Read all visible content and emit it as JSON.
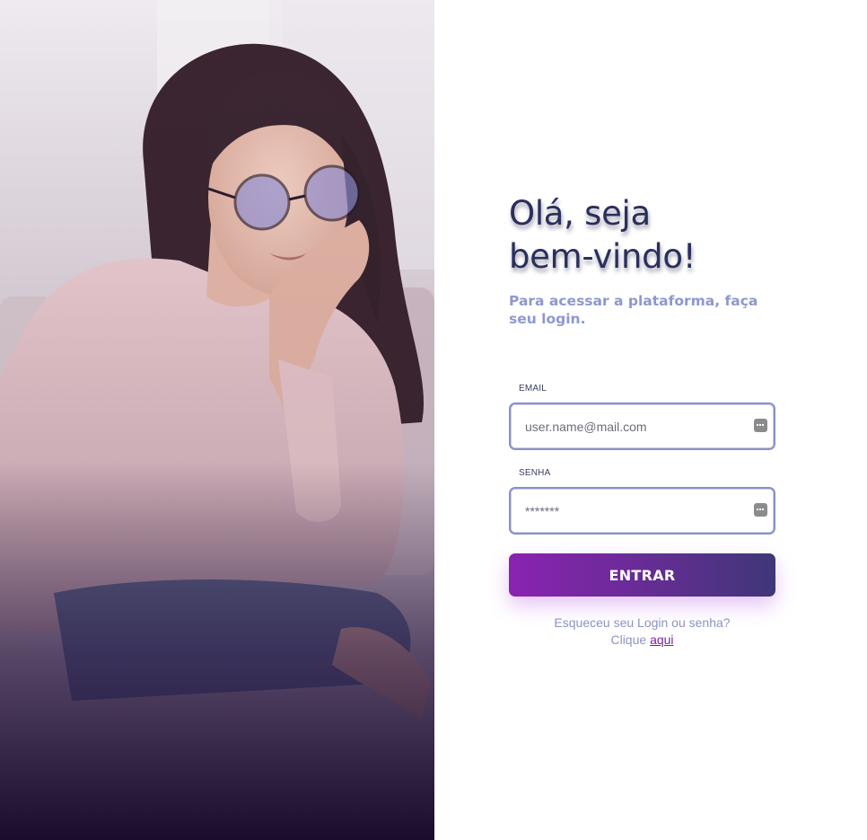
{
  "hero": {
    "photo": "woman-with-glasses-on-sofa-photo"
  },
  "login": {
    "heading_line1": "Olá, seja",
    "heading_line2": "bem-vindo!",
    "subtitle": "Para acessar a plataforma, faça seu login.",
    "email": {
      "label": "EMAIL",
      "placeholder": "user.name@mail.com",
      "icon": "password-manager-key-icon"
    },
    "password": {
      "label": "SENHA",
      "placeholder": "*******",
      "icon": "password-manager-key-icon"
    },
    "submit_label": "ENTRAR",
    "forgot_text": "Esqueceu seu Login ou senha?",
    "click_prefix": "Clique",
    "click_link": "aqui"
  },
  "colors": {
    "heading": "#2b2f5c",
    "subtitle": "#8e98cf",
    "button_gradient_start": "#8a23b1",
    "button_gradient_end": "#3f3778",
    "input_border": "#8990c6",
    "link": "#7b1ea2"
  }
}
